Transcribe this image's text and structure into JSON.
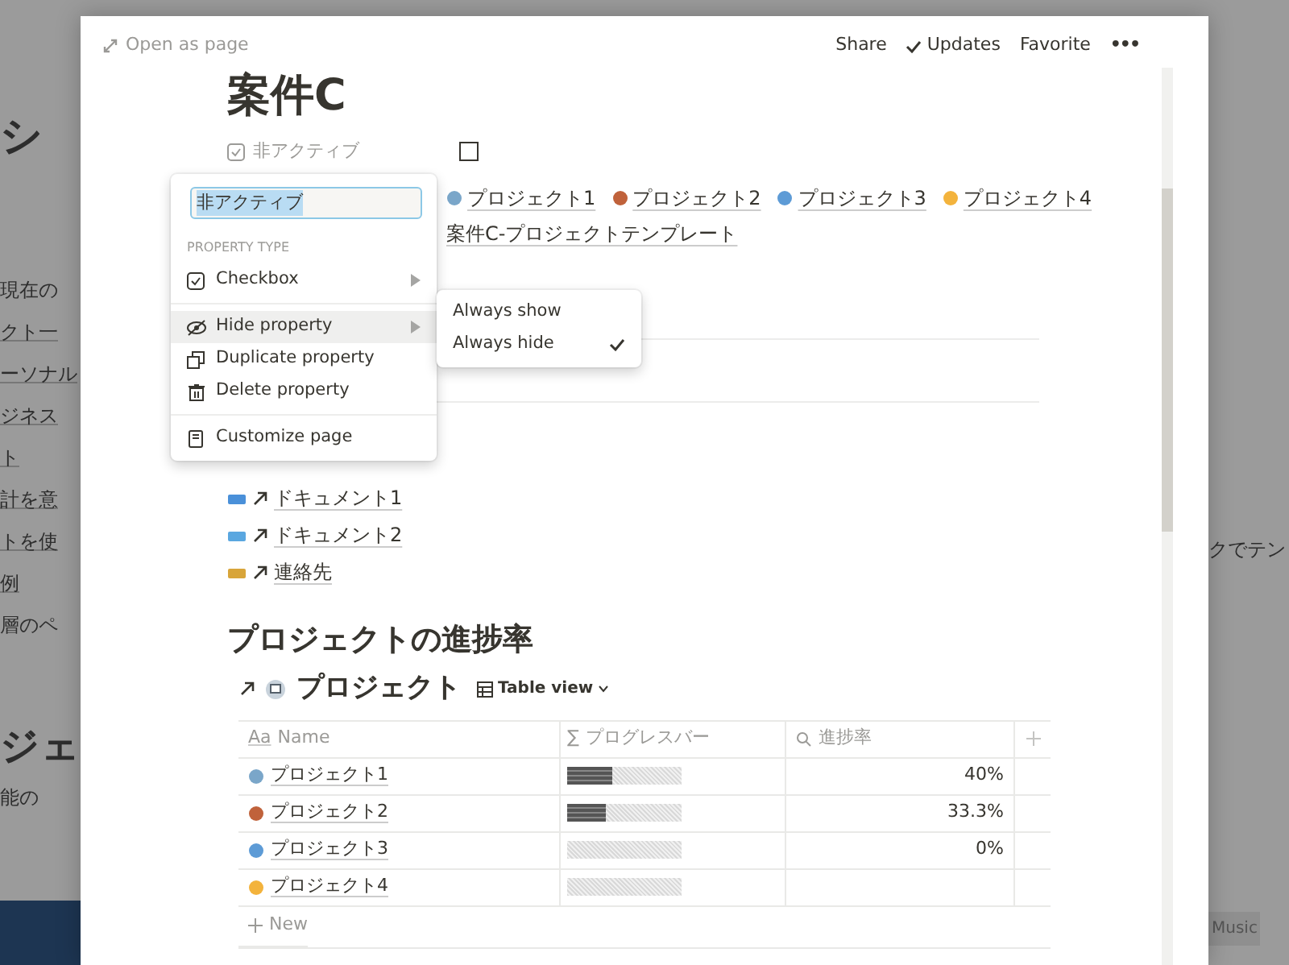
{
  "background": {
    "left_texts": [
      {
        "text": "シ",
        "kind": "heading"
      },
      {
        "text": "現在の",
        "kind": "text"
      },
      {
        "text": "クト一",
        "kind": "link"
      },
      {
        "text": "ーソナル",
        "kind": "link"
      },
      {
        "text": "ジネス",
        "kind": "link"
      },
      {
        "text": "ト",
        "kind": "link"
      },
      {
        "text": "計を意",
        "kind": "link"
      },
      {
        "text": "トを使",
        "kind": "link"
      },
      {
        "text": "例",
        "kind": "link"
      },
      {
        "text": "層のペ",
        "kind": "text"
      },
      {
        "text": "ジェ",
        "kind": "heading"
      },
      {
        "text": "能の",
        "kind": "text"
      }
    ],
    "right_texts": [
      {
        "text": "クでテン",
        "kind": "text"
      },
      {
        "text": "Music",
        "kind": "badge"
      }
    ]
  },
  "header": {
    "open_as_page": "Open as page",
    "actions": [
      {
        "label": "Share",
        "kind": "text"
      },
      {
        "label": "Updates",
        "kind": "check"
      },
      {
        "label": "Favorite",
        "kind": "text"
      },
      {
        "label": "•••",
        "kind": "more"
      }
    ]
  },
  "page": {
    "title": "案件C",
    "property": {
      "name": "非アクティブ",
      "checked": false
    },
    "relations": [
      {
        "label": "プロジェクト1"
      },
      {
        "label": "プロジェクト2"
      },
      {
        "label": "プロジェクト3"
      },
      {
        "label": "プロジェクト4"
      }
    ],
    "template": "案件C-プロジェクトテンプレート",
    "resources": [
      {
        "label": "ドキュメント1"
      },
      {
        "label": "ドキュメント2"
      },
      {
        "label": "連絡先"
      }
    ],
    "section_heading": "プロジェクトの進捗率",
    "database": {
      "title": "プロジェクト",
      "view": "Table view",
      "columns": [
        {
          "label": "Name",
          "kind": "title",
          "type_mark": "Aa"
        },
        {
          "label": "プログレスバー",
          "kind": "formula",
          "type_mark": "∑"
        },
        {
          "label": "進捗率",
          "kind": "search"
        }
      ],
      "rows": [
        {
          "name": "プロジェクト1",
          "level": 0.4,
          "percent": "40%"
        },
        {
          "name": "プロジェクト2",
          "level": 0.333,
          "percent": "33.3%"
        },
        {
          "name": "プロジェクト3",
          "level": 0,
          "percent": "0%"
        },
        {
          "name": "プロジェクト4",
          "level": 0
        }
      ],
      "new_row": "New"
    }
  },
  "menu": {
    "field_value": "非アクティブ",
    "text_selected": true,
    "section_label": "PROPERTY TYPE",
    "groups": [
      [
        {
          "label": "Checkbox",
          "kind": "checkbox",
          "submenu": true,
          "selected": false
        }
      ],
      [
        {
          "label": "Hide property",
          "kind": "hide",
          "submenu": true,
          "selected": true
        },
        {
          "label": "Duplicate property",
          "kind": "duplicate",
          "submenu": false,
          "selected": false
        },
        {
          "label": "Delete property",
          "kind": "delete",
          "submenu": false,
          "selected": false
        }
      ],
      [
        {
          "label": "Customize page",
          "kind": "page",
          "submenu": false,
          "selected": false
        }
      ]
    ],
    "submenu": [
      {
        "label": "Always show",
        "checked": false
      },
      {
        "label": "Always hide",
        "checked": true
      }
    ]
  }
}
